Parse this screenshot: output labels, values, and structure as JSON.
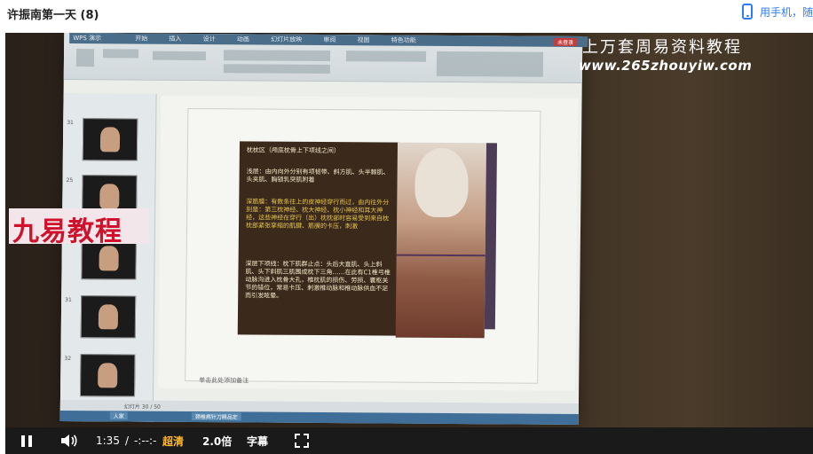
{
  "header": {
    "title": "许振南第一天 (8)",
    "phone_link": "用手机，随"
  },
  "video": {
    "watermark_title": "上万套周易资料教程",
    "watermark_url": "www.265zhouyiw.com",
    "badge_text": "九易教程",
    "screen": {
      "app_brand": "WPS 演示",
      "tabs": "开始 插入 设计 动画 幻灯片放映 审阅 视图 特色功能",
      "login": "未登录",
      "slide_heading": "枕枕区（颅底枕骨上下项线之间）",
      "slide_bullet_1": "浅层：由内向外分别有项韧带、斜方肌、头半棘肌、头夹肌、胸锁乳突肌附着",
      "slide_bullet_2": "深筋膜：有数条往上的皮神经穿行而过，由内往外分别是：第三枕神经、枕大神经、枕小神经和耳大神经，这些神经在穿行（出）枕枕部时容易受到来自枕枕部紧张挛缩的肌腱、筋膜的卡压，刺激",
      "slide_bullet_3": "深层下项线：枕下肌群止点：头后大直肌、头上斜肌、头下斜肌三肌围成枕下三角……在此有C1椎弓椎动脉沟进入枕骨大孔，椎枕肌的损伤、劳损、寰枢关节的错位，常易卡压、刺激椎动脉和椎动脉供血不足而引发眩晕。",
      "notes_placeholder": "单击此处添加备注",
      "status_text": "幻灯片 30 / 50",
      "taskbar_item_1": "人家",
      "taskbar_item_2": "颈椎病针刀精品定"
    }
  },
  "controls": {
    "time_current": "1:35",
    "time_separator": "/",
    "time_total": "-:--:-",
    "quality": "超清",
    "speed": "2.0倍",
    "subtitles": "字幕"
  }
}
